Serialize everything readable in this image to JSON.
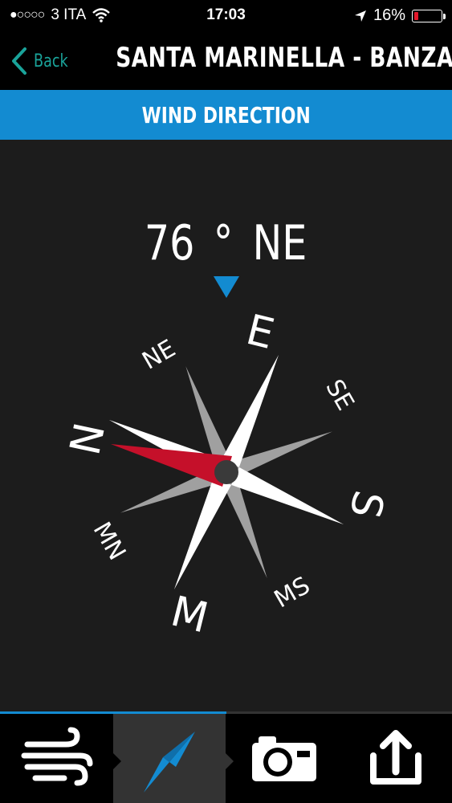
{
  "status_bar": {
    "signal_dots": "●○○○○",
    "carrier": "3 ITA",
    "time": "17:03",
    "battery_percent": "16%",
    "battery_level": 0.16,
    "icons": [
      "wifi-icon",
      "location-arrow-icon",
      "battery-icon"
    ]
  },
  "nav": {
    "back_label": "Back",
    "title": "SANTA MARINELLA - BANZAI"
  },
  "section": {
    "title": "WIND DIRECTION"
  },
  "reading": {
    "degrees": "76",
    "degree_symbol": "°",
    "direction": "NE"
  },
  "compass": {
    "labels": [
      "E",
      "SE",
      "S",
      "MS",
      "M",
      "MN",
      "N",
      "NE"
    ],
    "needle_color": "#c5102a",
    "pointer_color": "#138bd1"
  },
  "tabs": {
    "items": [
      "wind-icon",
      "compass-icon",
      "camera-icon",
      "share-icon"
    ],
    "active_index": 1
  },
  "colors": {
    "accent": "#138bd1",
    "back_accent": "#1aa39a",
    "background": "#1c1c1c"
  }
}
